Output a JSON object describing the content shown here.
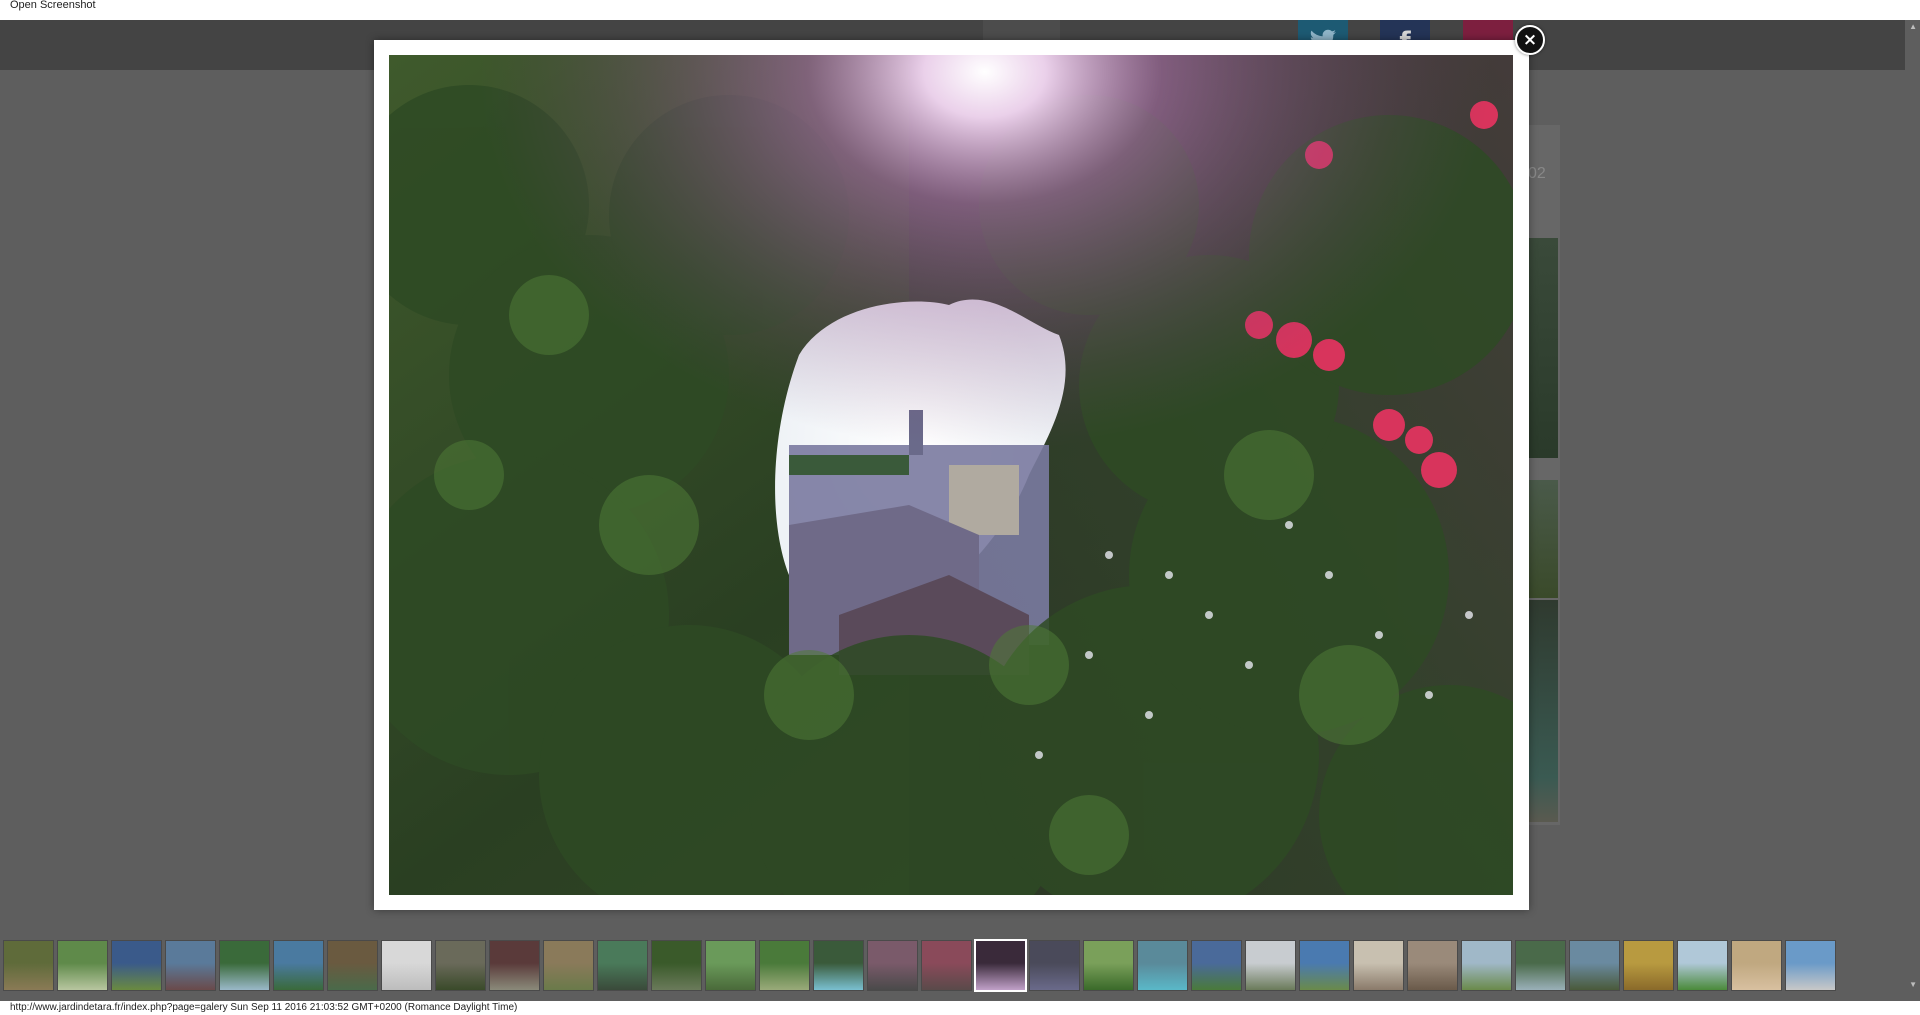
{
  "window": {
    "title": "Open Screenshot"
  },
  "status_bar": {
    "text": "http://www.jardindetara.fr/index.php?page=galery Sun Sep 11 2016 21:03:52 GMT+0200 (Romance Daylight Time)"
  },
  "background_page": {
    "partial_text": "02"
  },
  "social_buttons": [
    {
      "name": "twitter",
      "glyph": ""
    },
    {
      "name": "facebook",
      "glyph": "f"
    },
    {
      "name": "pinterest",
      "glyph": ""
    }
  ],
  "lightbox": {
    "close_glyph": "×"
  },
  "thumbnails": [
    {
      "c1": "#5f6b3a",
      "c2": "#8a7a55"
    },
    {
      "c1": "#5f8a4a",
      "c2": "#b8c6a0"
    },
    {
      "c1": "#3a5a8a",
      "c2": "#6a8a40"
    },
    {
      "c1": "#5a7a9a",
      "c2": "#6a4a4a"
    },
    {
      "c1": "#3a6a3a",
      "c2": "#9ab8c8"
    },
    {
      "c1": "#4a7aa0",
      "c2": "#3a6a3a"
    },
    {
      "c1": "#6a5a40",
      "c2": "#4a6a4a"
    },
    {
      "c1": "#d8d8d8",
      "c2": "#bdbdbd"
    },
    {
      "c1": "#6a6a5a",
      "c2": "#3a4a2a"
    },
    {
      "c1": "#5a3a3a",
      "c2": "#8a8a7a"
    },
    {
      "c1": "#8a7a5a",
      "c2": "#6a7a4a"
    },
    {
      "c1": "#4a7a5a",
      "c2": "#3a4a3a"
    },
    {
      "c1": "#3a5a2a",
      "c2": "#6a7a5a"
    },
    {
      "c1": "#6a9a5a",
      "c2": "#4a6a3a"
    },
    {
      "c1": "#4a7a3a",
      "c2": "#9aaa7a"
    },
    {
      "c1": "#3a5a3a",
      "c2": "#7ac0d0"
    },
    {
      "c1": "#7a5a6a",
      "c2": "#4a4a4a"
    },
    {
      "c1": "#8a4a5a",
      "c2": "#5a4a4a"
    },
    {
      "c1": "#3a2a3a",
      "c2": "#c0a0c8"
    },
    {
      "c1": "#4a4a5a",
      "c2": "#6a6a8a"
    },
    {
      "c1": "#7aa05a",
      "c2": "#3a6a2a"
    },
    {
      "c1": "#5a8a9a",
      "c2": "#5ab8c8"
    },
    {
      "c1": "#4a6a9a",
      "c2": "#4a7a3a"
    },
    {
      "c1": "#c8ccd0",
      "c2": "#6a7a5a"
    },
    {
      "c1": "#4a7ab0",
      "c2": "#6a8a4a"
    },
    {
      "c1": "#c8c0b0",
      "c2": "#8a7a6a"
    },
    {
      "c1": "#9a8a7a",
      "c2": "#6a5a4a"
    },
    {
      "c1": "#a0b8c8",
      "c2": "#6a8a4a"
    },
    {
      "c1": "#4a6a4a",
      "c2": "#9ab0b8"
    },
    {
      "c1": "#6a8aa0",
      "c2": "#4a5a3a"
    },
    {
      "c1": "#b89a40",
      "c2": "#8a6a2a"
    },
    {
      "c1": "#b0c8d8",
      "c2": "#4a8a3a"
    },
    {
      "c1": "#c0a880",
      "c2": "#d8c0a0"
    },
    {
      "c1": "#6a9ac8",
      "c2": "#c8c8c8"
    }
  ],
  "active_thumbnail_index": 18
}
